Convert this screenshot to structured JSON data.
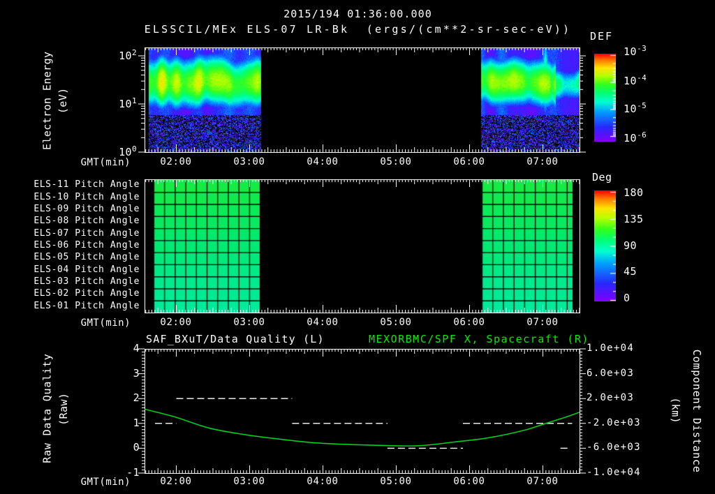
{
  "colors": {
    "background": "#000000",
    "foreground": "#ffffff",
    "accent_green_title": "#00ee00",
    "curve_green": "#00cc22",
    "quality_line_white": "#ffffff"
  },
  "header": {
    "title": "2015/194 01:36:00.000",
    "subtitle": "ELSSCIL/MEx ELS-07 LR-Bk  (ergs/(cm**2-sr-sec-eV))"
  },
  "gmt_label": "GMT(min)",
  "time_ticks": [
    "02:00",
    "03:00",
    "04:00",
    "05:00",
    "06:00",
    "07:00"
  ],
  "spectrogram_panel": {
    "ylabel_line1": "Electron Energy",
    "ylabel_line2": "(eV)",
    "energy_tick_exponents": [
      "2",
      "1",
      "0"
    ],
    "colorbar": {
      "title": "DEF",
      "tick_exponents": [
        "-3",
        "-4",
        "-5",
        "-6"
      ]
    }
  },
  "pitch_panel": {
    "row_labels": [
      "ELS-11 Pitch Angle",
      "ELS-10 Pitch Angle",
      "ELS-09 Pitch Angle",
      "ELS-08 Pitch Angle",
      "ELS-07 Pitch Angle",
      "ELS-06 Pitch Angle",
      "ELS-05 Pitch Angle",
      "ELS-04 Pitch Angle",
      "ELS-03 Pitch Angle",
      "ELS-02 Pitch Angle",
      "ELS-01 Pitch Angle"
    ],
    "colorbar": {
      "title": "Deg",
      "ticks": [
        "180",
        "135",
        "90",
        "45",
        "0"
      ]
    }
  },
  "quality_panel": {
    "title_left": "SAF_BXuT/Data Quality (L)",
    "title_right": "MEXORBMC/SPF X, Spacecraft (R)",
    "ylabel_left_line1": "Raw Data Quality",
    "ylabel_left_line2": "(Raw)",
    "ylabel_right_line1": "Component Distance",
    "ylabel_right_line2": "(km)",
    "yticks_left": [
      "4",
      "3",
      "2",
      "1",
      "0",
      "-1"
    ],
    "yticks_right": [
      "1.0e+04",
      "6.0e+03",
      "2.0e+03",
      "-2.0e+03",
      "-6.0e+03",
      "-1.0e+04"
    ]
  },
  "chart_data": [
    {
      "type": "heatmap",
      "name": "electron-energy-spectrogram",
      "title": "ELSSCIL/MEx ELS-07 LR-Bk",
      "x_axis": {
        "label": "GMT(min)",
        "unit": "hours",
        "range": [
          1.567,
          7.5
        ],
        "tick_labels": [
          "02:00",
          "03:00",
          "04:00",
          "05:00",
          "06:00",
          "07:00"
        ]
      },
      "y_axis": {
        "label": "Electron Energy (eV)",
        "scale": "log",
        "range_ev": [
          1,
          150
        ],
        "tick_labels": [
          "10^2",
          "10^1",
          "10^0"
        ]
      },
      "z_axis": {
        "label": "DEF",
        "unit": "ergs/(cm**2-sr-sec-eV)",
        "scale": "log",
        "range": [
          1e-06,
          0.001
        ],
        "tick_labels": [
          "10^-3",
          "10^-4",
          "10^-5",
          "10^-6"
        ]
      },
      "background_flux_log10": -5.5,
      "low_energy_noise_flux_log10": -5.7,
      "segments": [
        {
          "t_start": 1.615,
          "t_end": 3.148,
          "band_center_ev": 28,
          "band_sigma_log": 0.3,
          "peak_flux_log10": -3.8,
          "variability": 0.33
        },
        {
          "t_start": 6.148,
          "t_end": 7.5,
          "band_center_ev": 28,
          "band_sigma_log": 0.28,
          "peak_flux_log10": -3.95,
          "variability": 0.28,
          "burst_event": {
            "t": 7.03,
            "flux_log10": -4.2,
            "center_log_ev": 1.55,
            "sigma_log": 0.5
          },
          "decay_after": 7.17,
          "decay_peak_flux_log10": -4.45,
          "decay_sigma_log": 0.2
        }
      ]
    },
    {
      "type": "heatmap",
      "name": "els-pitch-angles",
      "z_axis": {
        "label": "Deg",
        "range": [
          0,
          180
        ],
        "tick_labels": [
          "180",
          "135",
          "90",
          "45",
          "0"
        ]
      },
      "rows": [
        {
          "label": "ELS-11 Pitch Angle",
          "angle_deg": 108
        },
        {
          "label": "ELS-10 Pitch Angle",
          "angle_deg": 106
        },
        {
          "label": "ELS-09 Pitch Angle",
          "angle_deg": 104
        },
        {
          "label": "ELS-08 Pitch Angle",
          "angle_deg": 102
        },
        {
          "label": "ELS-07 Pitch Angle",
          "angle_deg": 100
        },
        {
          "label": "ELS-06 Pitch Angle",
          "angle_deg": 98
        },
        {
          "label": "ELS-05 Pitch Angle",
          "angle_deg": 96
        },
        {
          "label": "ELS-04 Pitch Angle",
          "angle_deg": 94
        },
        {
          "label": "ELS-03 Pitch Angle",
          "angle_deg": 92
        },
        {
          "label": "ELS-02 Pitch Angle",
          "angle_deg": 91
        },
        {
          "label": "ELS-01 Pitch Angle",
          "angle_deg": 89
        }
      ],
      "blocks": [
        {
          "t_start": 1.69,
          "t_end": 3.138
        },
        {
          "t_start": 6.167,
          "t_end": 7.405
        }
      ],
      "grid_minutes": 8.7
    },
    {
      "type": "line",
      "name": "raw-data-quality",
      "series_label": "SAF_BXuT/Data Quality (L)",
      "style": "dashed",
      "color": "#ffffff",
      "y_axis": {
        "label": "Raw Data Quality (Raw)",
        "range": [
          -1,
          4
        ]
      },
      "segments": [
        {
          "t_start": 1.71,
          "t_end": 2.0,
          "value": 1
        },
        {
          "t_start": 2.0,
          "t_end": 3.58,
          "value": 2
        },
        {
          "t_start": 3.58,
          "t_end": 4.88,
          "value": 1
        },
        {
          "t_start": 4.88,
          "t_end": 5.91,
          "value": 0
        },
        {
          "t_start": 5.91,
          "t_end": 7.4,
          "value": 1
        },
        {
          "t_start": 7.24,
          "t_end": 7.36,
          "value": 0
        }
      ]
    },
    {
      "type": "line",
      "name": "spacecraft-x-component-distance",
      "series_label": "MEXORBMC/SPF X, Spacecraft (R)",
      "color": "#00cc22",
      "y_axis": {
        "label": "Component Distance (km)",
        "range": [
          -10000,
          10000
        ]
      },
      "points": [
        [
          1.57,
          280
        ],
        [
          1.98,
          -960
        ],
        [
          2.45,
          -2760
        ],
        [
          2.93,
          -3800
        ],
        [
          3.4,
          -4520
        ],
        [
          3.88,
          -5120
        ],
        [
          4.36,
          -5400
        ],
        [
          4.83,
          -5560
        ],
        [
          5.31,
          -5600
        ],
        [
          5.79,
          -5000
        ],
        [
          6.26,
          -4320
        ],
        [
          6.74,
          -3120
        ],
        [
          7.04,
          -2000
        ],
        [
          7.31,
          -1000
        ],
        [
          7.5,
          -200
        ]
      ]
    }
  ]
}
